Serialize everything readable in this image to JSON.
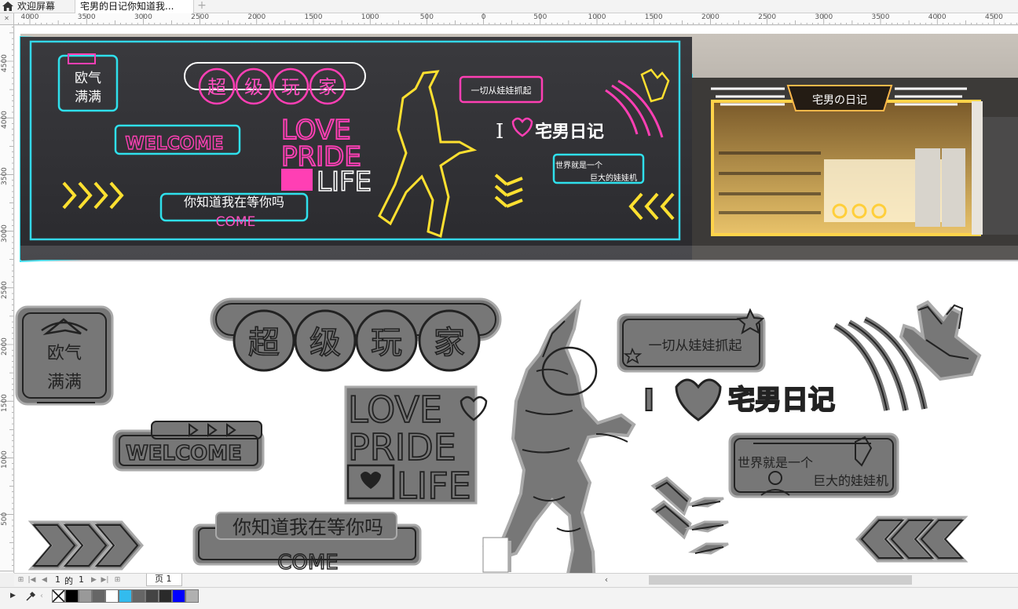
{
  "tabs": {
    "home_label": "欢迎屏幕",
    "doc_label": "宅男的日记你知道我...",
    "add_label": "+"
  },
  "ruler_h": [
    "4000",
    "3500",
    "3000",
    "2500",
    "2000",
    "1500",
    "1000",
    "500",
    "0",
    "500",
    "1000",
    "1500",
    "2000",
    "2500",
    "3000",
    "3500",
    "4000",
    "4500"
  ],
  "ruler_v": [
    "4500",
    "4000",
    "3500",
    "3000",
    "2500",
    "2000",
    "1500",
    "1000",
    "500"
  ],
  "ruler_corner": "✕",
  "design": {
    "top_left_box": [
      "欧气",
      "满满"
    ],
    "title_chars": [
      "超",
      "级",
      "玩",
      "家"
    ],
    "welcome": "WELCOME",
    "love_lines": [
      "LOVE",
      "PRIDE",
      "LIFE"
    ],
    "waiting": "你知道我在等你吗",
    "come": "COME",
    "bubble_top": "一切从娃娃抓起",
    "i_letter": "I",
    "brand": "宅男日记",
    "bubble_bottom_1": "世界就是一个",
    "bubble_bottom_2": "巨大的娃娃机",
    "shop_sign": "宅男の日记"
  },
  "pagebar": {
    "page_current": "1",
    "of_label": "的",
    "page_total": "1",
    "page_tab": "页 1"
  },
  "palette": {
    "colors": [
      "#000000",
      "#999999",
      "#666666",
      "#ffffff",
      "#33bbee",
      "#666666",
      "#444444",
      "#2a2a2a",
      "#0000ff",
      "#b0b0b0"
    ]
  }
}
